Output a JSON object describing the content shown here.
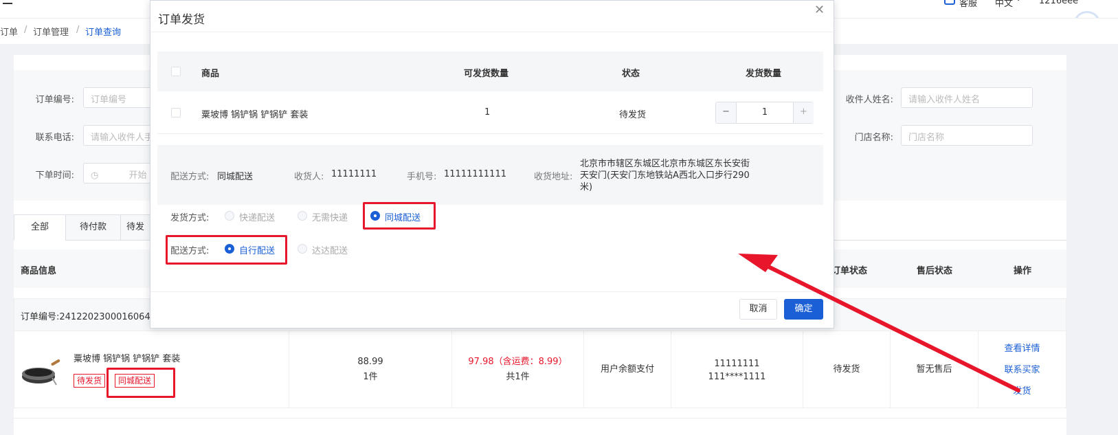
{
  "header": {
    "cs_label": "客服",
    "lang_label": "中文",
    "user_label": "1216eee",
    "menu_icon": "menu-icon"
  },
  "breadcrumb": {
    "items": [
      "订单",
      "订单管理",
      "订单查询"
    ]
  },
  "search": {
    "order_no_label": "订单编号:",
    "order_no_placeholder": "订单编号",
    "phone_label": "联系电话:",
    "phone_placeholder": "请输入收件人手",
    "time_label": "下单时间:",
    "time_start_placeholder": "开始",
    "receiver_label": "收件人姓名:",
    "receiver_placeholder": "请输入收件人姓名",
    "store_label": "门店名称:",
    "store_placeholder": "门店名称"
  },
  "tabs": [
    "全部",
    "待付款",
    "待发"
  ],
  "table": {
    "headers": {
      "product": "商品信息",
      "order_status": "订单状态",
      "after_sale": "售后状态",
      "actions": "操作"
    },
    "order_no": "订单编号:2412202300016064",
    "row": {
      "product_name": "粟坡博 锅铲锅 铲锅铲 套装",
      "tag_status": "待发货",
      "tag_delivery": "同城配送",
      "price": "88.99",
      "qty": "1件",
      "total": "97.98（含运费：8.99）",
      "total_count": "共1件",
      "payment": "用户余额支付",
      "receiver_name": "11111111",
      "receiver_phone": "111****1111",
      "status": "待发货",
      "after_sale": "暂无售后",
      "action_detail": "查看详情",
      "action_contact": "联系买家",
      "action_ship": "发货"
    }
  },
  "modal": {
    "title": "订单发货",
    "columns": {
      "product": "商品",
      "available": "可发货数量",
      "status": "状态",
      "ship_qty": "发货数量"
    },
    "item": {
      "name": "粟坡博 锅铲锅 铲锅铲 套装",
      "available": "1",
      "status": "待发货",
      "qty": "1"
    },
    "info": {
      "delivery_label": "配送方式:",
      "delivery_value": "同城配送",
      "receiver_label": "收货人:",
      "receiver_value": "11111111",
      "phone_label": "手机号:",
      "phone_value": "11111111111",
      "address_label": "收货地址:",
      "address_value": "北京市市辖区东城区北京市东城区东长安街天安门(天安门东地铁站A西北入口步行290米)"
    },
    "ship_method": {
      "label": "发货方式:",
      "options": [
        "快递配送",
        "无需快递",
        "同城配送"
      ],
      "selected": "同城配送"
    },
    "dispatch_method": {
      "label": "配送方式:",
      "options": [
        "自行配送",
        "达达配送"
      ],
      "selected": "自行配送"
    },
    "cancel_label": "取消",
    "confirm_label": "确定"
  },
  "colors": {
    "primary": "#1a5fd6",
    "highlight": "#e8162b"
  }
}
